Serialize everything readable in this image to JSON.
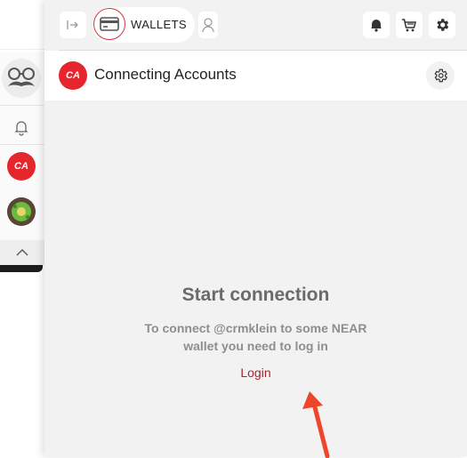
{
  "toolbar": {
    "wallets_label": "WALLETS"
  },
  "header": {
    "title": "Connecting Accounts",
    "logo_text": "CA"
  },
  "sidebar": {
    "ca_text": "CA"
  },
  "main": {
    "title": "Start connection",
    "message": "To connect @crmklein to some NEAR wallet you need to log in",
    "login_label": "Login"
  },
  "colors": {
    "brand_red": "#e5262d",
    "link_red": "#b0202a",
    "panel_bg": "#f2f2f2"
  },
  "icons": [
    "collapse-icon",
    "wallet-card-icon",
    "user-icon",
    "bell-icon",
    "cart-icon",
    "gear-icon",
    "mustache-avatar-icon",
    "chevron-up-icon",
    "arrow-pointer"
  ]
}
